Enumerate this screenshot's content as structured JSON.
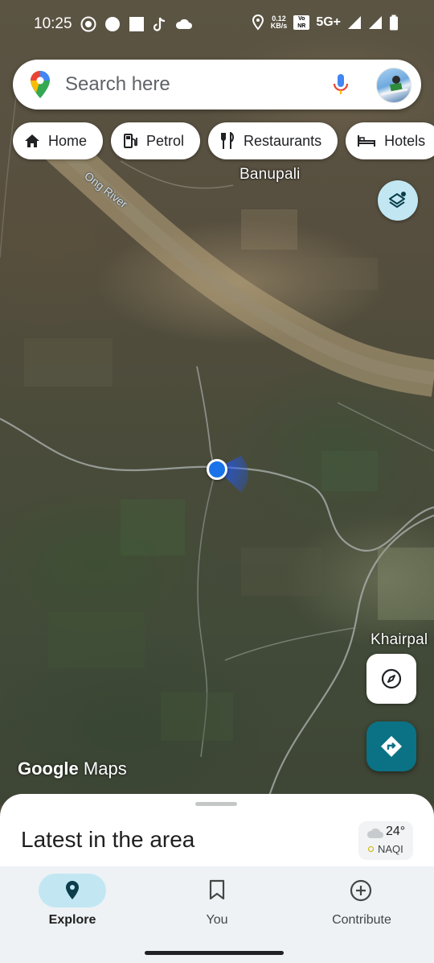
{
  "status_bar": {
    "time": "10:25",
    "speed_value": "0.12",
    "speed_unit": "KB/s",
    "volte": "Vo NR",
    "network": "5G+"
  },
  "search": {
    "placeholder": "Search here"
  },
  "chips": [
    {
      "label": "Home",
      "icon": "home-icon"
    },
    {
      "label": "Petrol",
      "icon": "gas-station-icon"
    },
    {
      "label": "Restaurants",
      "icon": "fork-knife-icon"
    },
    {
      "label": "Hotels",
      "icon": "bed-icon"
    }
  ],
  "map": {
    "labels": {
      "banupali": "Banupali",
      "river": "Ong River",
      "khairpali": "Khairpal"
    },
    "watermark_brand": "Google",
    "watermark_product": "Maps"
  },
  "sheet": {
    "title": "Latest in the area"
  },
  "weather": {
    "temperature": "24°",
    "aqi_label": "NAQI"
  },
  "navbar": {
    "items": [
      {
        "label": "Explore",
        "icon": "explore-pin-icon",
        "active": true
      },
      {
        "label": "You",
        "icon": "bookmark-icon",
        "active": false
      },
      {
        "label": "Contribute",
        "icon": "add-circle-icon",
        "active": false
      }
    ]
  },
  "colors": {
    "accent": "#0b7285",
    "location": "#1a73e8",
    "active_pill": "#c2e7f3"
  }
}
